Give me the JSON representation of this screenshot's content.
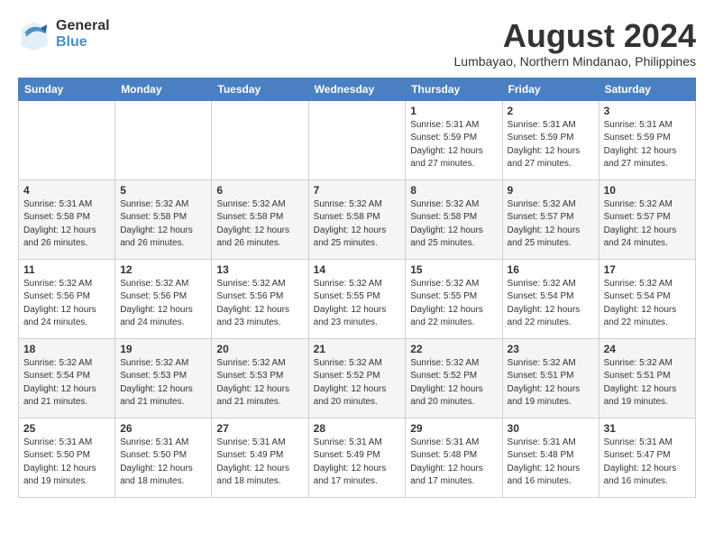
{
  "header": {
    "logo_general": "General",
    "logo_blue": "Blue",
    "month_year": "August 2024",
    "location": "Lumbayao, Northern Mindanao, Philippines"
  },
  "calendar": {
    "days_of_week": [
      "Sunday",
      "Monday",
      "Tuesday",
      "Wednesday",
      "Thursday",
      "Friday",
      "Saturday"
    ],
    "weeks": [
      [
        {
          "day": "",
          "info": ""
        },
        {
          "day": "",
          "info": ""
        },
        {
          "day": "",
          "info": ""
        },
        {
          "day": "",
          "info": ""
        },
        {
          "day": "1",
          "info": "Sunrise: 5:31 AM\nSunset: 5:59 PM\nDaylight: 12 hours\nand 27 minutes."
        },
        {
          "day": "2",
          "info": "Sunrise: 5:31 AM\nSunset: 5:59 PM\nDaylight: 12 hours\nand 27 minutes."
        },
        {
          "day": "3",
          "info": "Sunrise: 5:31 AM\nSunset: 5:59 PM\nDaylight: 12 hours\nand 27 minutes."
        }
      ],
      [
        {
          "day": "4",
          "info": "Sunrise: 5:31 AM\nSunset: 5:58 PM\nDaylight: 12 hours\nand 26 minutes."
        },
        {
          "day": "5",
          "info": "Sunrise: 5:32 AM\nSunset: 5:58 PM\nDaylight: 12 hours\nand 26 minutes."
        },
        {
          "day": "6",
          "info": "Sunrise: 5:32 AM\nSunset: 5:58 PM\nDaylight: 12 hours\nand 26 minutes."
        },
        {
          "day": "7",
          "info": "Sunrise: 5:32 AM\nSunset: 5:58 PM\nDaylight: 12 hours\nand 25 minutes."
        },
        {
          "day": "8",
          "info": "Sunrise: 5:32 AM\nSunset: 5:58 PM\nDaylight: 12 hours\nand 25 minutes."
        },
        {
          "day": "9",
          "info": "Sunrise: 5:32 AM\nSunset: 5:57 PM\nDaylight: 12 hours\nand 25 minutes."
        },
        {
          "day": "10",
          "info": "Sunrise: 5:32 AM\nSunset: 5:57 PM\nDaylight: 12 hours\nand 24 minutes."
        }
      ],
      [
        {
          "day": "11",
          "info": "Sunrise: 5:32 AM\nSunset: 5:56 PM\nDaylight: 12 hours\nand 24 minutes."
        },
        {
          "day": "12",
          "info": "Sunrise: 5:32 AM\nSunset: 5:56 PM\nDaylight: 12 hours\nand 24 minutes."
        },
        {
          "day": "13",
          "info": "Sunrise: 5:32 AM\nSunset: 5:56 PM\nDaylight: 12 hours\nand 23 minutes."
        },
        {
          "day": "14",
          "info": "Sunrise: 5:32 AM\nSunset: 5:55 PM\nDaylight: 12 hours\nand 23 minutes."
        },
        {
          "day": "15",
          "info": "Sunrise: 5:32 AM\nSunset: 5:55 PM\nDaylight: 12 hours\nand 22 minutes."
        },
        {
          "day": "16",
          "info": "Sunrise: 5:32 AM\nSunset: 5:54 PM\nDaylight: 12 hours\nand 22 minutes."
        },
        {
          "day": "17",
          "info": "Sunrise: 5:32 AM\nSunset: 5:54 PM\nDaylight: 12 hours\nand 22 minutes."
        }
      ],
      [
        {
          "day": "18",
          "info": "Sunrise: 5:32 AM\nSunset: 5:54 PM\nDaylight: 12 hours\nand 21 minutes."
        },
        {
          "day": "19",
          "info": "Sunrise: 5:32 AM\nSunset: 5:53 PM\nDaylight: 12 hours\nand 21 minutes."
        },
        {
          "day": "20",
          "info": "Sunrise: 5:32 AM\nSunset: 5:53 PM\nDaylight: 12 hours\nand 21 minutes."
        },
        {
          "day": "21",
          "info": "Sunrise: 5:32 AM\nSunset: 5:52 PM\nDaylight: 12 hours\nand 20 minutes."
        },
        {
          "day": "22",
          "info": "Sunrise: 5:32 AM\nSunset: 5:52 PM\nDaylight: 12 hours\nand 20 minutes."
        },
        {
          "day": "23",
          "info": "Sunrise: 5:32 AM\nSunset: 5:51 PM\nDaylight: 12 hours\nand 19 minutes."
        },
        {
          "day": "24",
          "info": "Sunrise: 5:32 AM\nSunset: 5:51 PM\nDaylight: 12 hours\nand 19 minutes."
        }
      ],
      [
        {
          "day": "25",
          "info": "Sunrise: 5:31 AM\nSunset: 5:50 PM\nDaylight: 12 hours\nand 19 minutes."
        },
        {
          "day": "26",
          "info": "Sunrise: 5:31 AM\nSunset: 5:50 PM\nDaylight: 12 hours\nand 18 minutes."
        },
        {
          "day": "27",
          "info": "Sunrise: 5:31 AM\nSunset: 5:49 PM\nDaylight: 12 hours\nand 18 minutes."
        },
        {
          "day": "28",
          "info": "Sunrise: 5:31 AM\nSunset: 5:49 PM\nDaylight: 12 hours\nand 17 minutes."
        },
        {
          "day": "29",
          "info": "Sunrise: 5:31 AM\nSunset: 5:48 PM\nDaylight: 12 hours\nand 17 minutes."
        },
        {
          "day": "30",
          "info": "Sunrise: 5:31 AM\nSunset: 5:48 PM\nDaylight: 12 hours\nand 16 minutes."
        },
        {
          "day": "31",
          "info": "Sunrise: 5:31 AM\nSunset: 5:47 PM\nDaylight: 12 hours\nand 16 minutes."
        }
      ]
    ]
  }
}
